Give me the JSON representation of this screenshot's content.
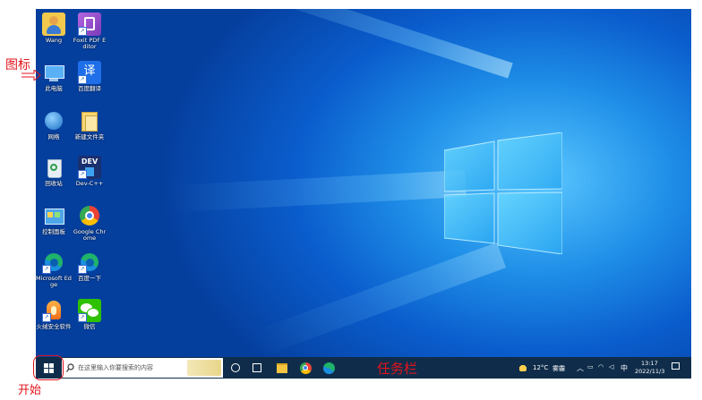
{
  "desktop": {
    "icons": [
      {
        "label": "Wang"
      },
      {
        "label": "Foxit PDF Editor"
      },
      {
        "label": "此电脑"
      },
      {
        "label": "百度翻译"
      },
      {
        "label": "网络"
      },
      {
        "label": "新建文件夹"
      },
      {
        "label": "回收站"
      },
      {
        "label": "Dev-C++"
      },
      {
        "label": "控制面板"
      },
      {
        "label": "Google Chrome"
      },
      {
        "label": "Microsoft Edge"
      },
      {
        "label": "百度一下"
      },
      {
        "label": "火绒安全软件"
      },
      {
        "label": "微信"
      }
    ],
    "dev_icon_text": "DEV",
    "translate_icon_text": "译"
  },
  "taskbar": {
    "search_placeholder": "在这里输入你要搜索的内容",
    "weather_temp": "12°C",
    "weather_desc": "雾霾",
    "ime": "中",
    "time": "13:17",
    "date": "2022/11/3"
  },
  "annotations": {
    "icon_label": "图标",
    "start_label": "开始",
    "taskbar_label": "任务栏"
  },
  "colors": {
    "taskbar": "#0f2d4a",
    "annotation": "#e2141c",
    "desktop_accent": "#1f8fe8"
  }
}
